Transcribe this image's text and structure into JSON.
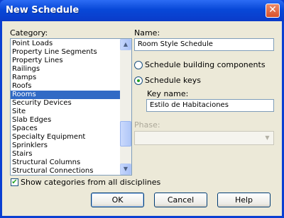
{
  "window": {
    "title": "New Schedule",
    "close_glyph": "✕"
  },
  "category": {
    "label": "Category:",
    "items": [
      "Point Loads",
      "Property Line Segments",
      "Property Lines",
      "Railings",
      "Ramps",
      "Roofs",
      "Rooms",
      "Security Devices",
      "Site",
      "Slab Edges",
      "Spaces",
      "Specialty Equipment",
      "Sprinklers",
      "Stairs",
      "Structural Columns",
      "Structural Connections"
    ],
    "selected": "Rooms"
  },
  "show_all": {
    "label": "Show categories from all disciplines",
    "checked": true
  },
  "name": {
    "label": "Name:",
    "value": "Room Style Schedule"
  },
  "options": {
    "building_components": {
      "label": "Schedule building components",
      "selected": false
    },
    "keys": {
      "label": "Schedule keys",
      "selected": true
    }
  },
  "key_name": {
    "label": "Key name:",
    "value": "Estilo de Habitaciones"
  },
  "phase": {
    "label": "Phase:",
    "value": ""
  },
  "buttons": {
    "ok": "OK",
    "cancel": "Cancel",
    "help": "Help"
  },
  "colors": {
    "title_bar": "#0a3fd2",
    "selection": "#316ac5",
    "dialog_bg": "#ece9d8"
  }
}
